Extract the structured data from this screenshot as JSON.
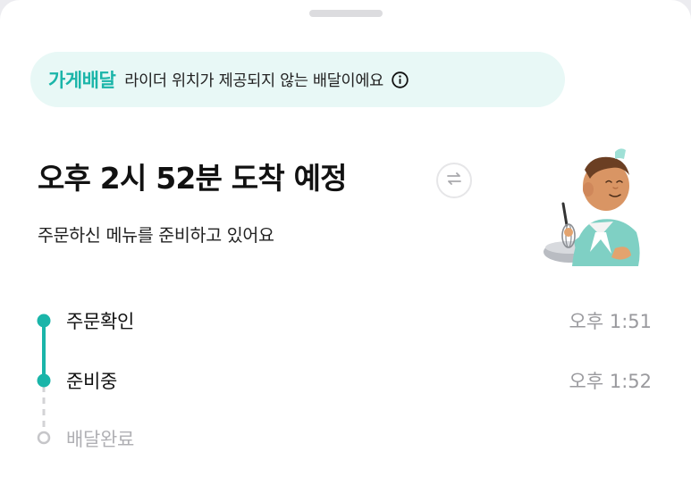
{
  "notice": {
    "brand": "가게배달",
    "text": "라이더 위치가 제공되지 않는 배달이에요"
  },
  "status": {
    "title": "오후 2시 52분 도착 예정",
    "subtitle": "주문하신 메뉴를 준비하고 있어요"
  },
  "steps": [
    {
      "label": "주문확인",
      "time": "오후 1:51",
      "done": true
    },
    {
      "label": "준비중",
      "time": "오후 1:52",
      "done": true
    },
    {
      "label": "배달완료",
      "time": "",
      "done": false
    }
  ],
  "colors": {
    "accent": "#1ab5a9",
    "inactive": "#c6c6c9"
  },
  "icons": {
    "info": "info-circle-icon",
    "refresh": "swap-arrows-icon",
    "illustration": "chef-whisking-illustration"
  }
}
